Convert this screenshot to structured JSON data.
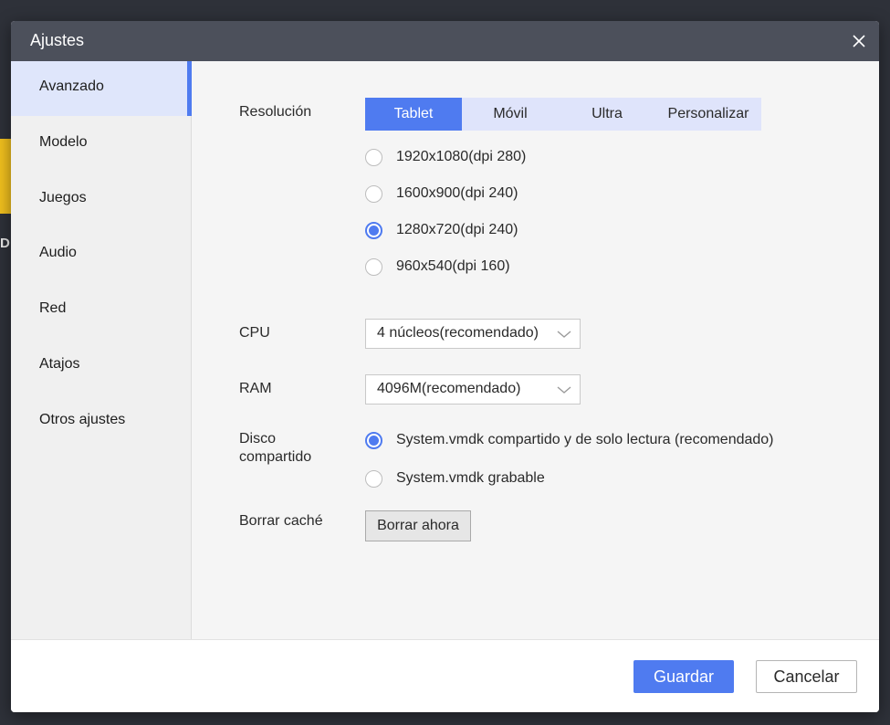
{
  "dialog": {
    "title": "Ajustes"
  },
  "background": {
    "partial_letter": "D"
  },
  "sidebar": {
    "items": [
      {
        "label": "Avanzado",
        "active": true
      },
      {
        "label": "Modelo"
      },
      {
        "label": "Juegos"
      },
      {
        "label": "Audio"
      },
      {
        "label": "Red"
      },
      {
        "label": "Atajos"
      },
      {
        "label": "Otros ajustes"
      }
    ]
  },
  "resolution": {
    "label": "Resolución",
    "tabs": [
      "Tablet",
      "Móvil",
      "Ultra",
      "Personalizar"
    ],
    "selected_tab": "Tablet",
    "options": [
      "1920x1080(dpi 280)",
      "1600x900(dpi 240)",
      "1280x720(dpi 240)",
      "960x540(dpi 160)"
    ],
    "selected_option": "1280x720(dpi 240)"
  },
  "cpu": {
    "label": "CPU",
    "value": "4 núcleos(recomendado)"
  },
  "ram": {
    "label": "RAM",
    "value": "4096M(recomendado)"
  },
  "disk": {
    "label_line1": "Disco",
    "label_line2": "compartido",
    "options": [
      "System.vmdk compartido y de solo lectura (recomendado)",
      "System.vmdk grabable"
    ],
    "selected_option": "System.vmdk compartido y de solo lectura (recomendado)"
  },
  "cache": {
    "label": "Borrar caché",
    "button_label": "Borrar ahora"
  },
  "footer": {
    "save_label": "Guardar",
    "cancel_label": "Cancelar"
  },
  "colors": {
    "accent": "#4f7bf0",
    "titlebar": "#4c505b",
    "sidebar_active_bg": "#dfe6fb",
    "segment_bg": "#dfe4fb"
  }
}
